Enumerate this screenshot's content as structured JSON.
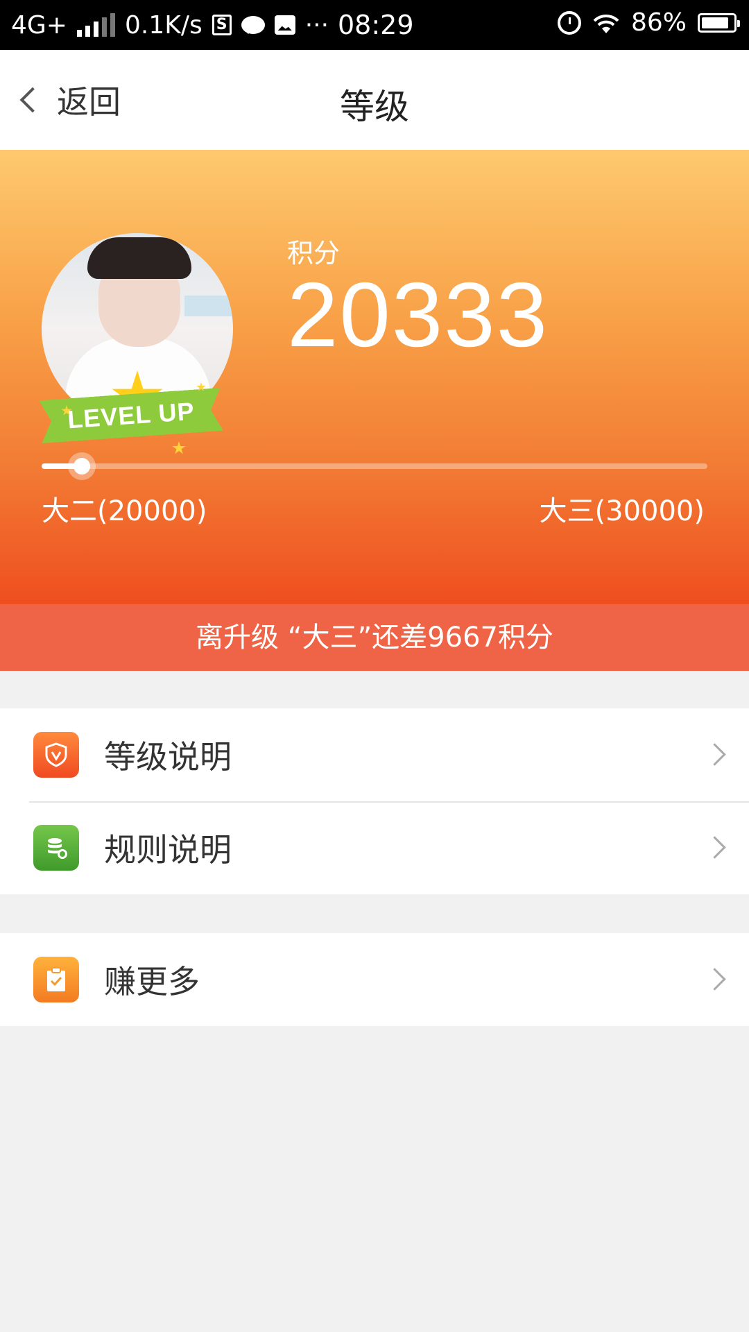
{
  "status_bar": {
    "network": "4G+",
    "speed": "0.1K/s",
    "s_icon_text": "S",
    "more": "···",
    "time": "08:29",
    "battery": "86%",
    "battery_level": 0.86
  },
  "header": {
    "back_label": "返回",
    "title": "等级"
  },
  "profile": {
    "badge_text": "LEVEL UP",
    "points_label": "积分",
    "points_value": "20333",
    "progress": {
      "current_level": "大二(20000)",
      "next_level": "大三(30000)",
      "min": 20000,
      "max": 30000,
      "value": 20333
    },
    "upgrade_message": "离升级 “大三”还差9667积分"
  },
  "menu": {
    "group1": [
      {
        "label": "等级说明",
        "icon": "shield-icon"
      },
      {
        "label": "规则说明",
        "icon": "coins-icon"
      }
    ],
    "group2": [
      {
        "label": "赚更多",
        "icon": "clipboard-check-icon"
      }
    ]
  },
  "colors": {
    "hero_top": "#fec96e",
    "hero_bottom": "#ef4e1f",
    "banner": "#ef6447",
    "background": "#f1f1f1"
  }
}
